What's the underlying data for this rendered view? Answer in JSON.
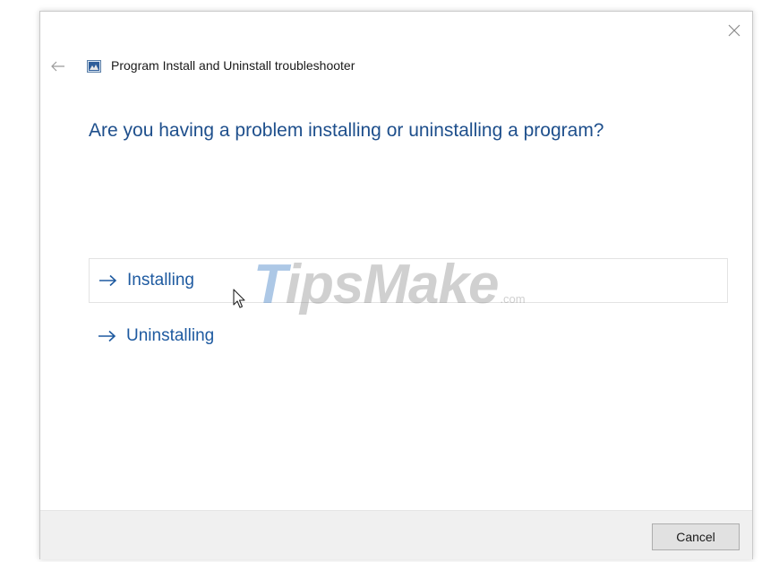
{
  "window": {
    "title": "Program Install and Uninstall troubleshooter",
    "icons": {
      "back": "back-arrow-icon",
      "close": "close-icon",
      "app": "troubleshooter-app-icon"
    }
  },
  "main": {
    "heading": "Are you having a problem installing or uninstalling a program?",
    "options": [
      {
        "label": "Installing",
        "icon": "right-arrow-icon",
        "state": "hovered"
      },
      {
        "label": "Uninstalling",
        "icon": "right-arrow-icon",
        "state": "normal"
      }
    ]
  },
  "watermark": {
    "main_initial": "T",
    "main_rest": "ipsMake",
    "suffix": ".com"
  },
  "footer": {
    "cancel_label": "Cancel"
  },
  "colors": {
    "heading": "#1e4f8c",
    "link": "#1e5aa0",
    "footer_bg": "#f0f0f0"
  }
}
